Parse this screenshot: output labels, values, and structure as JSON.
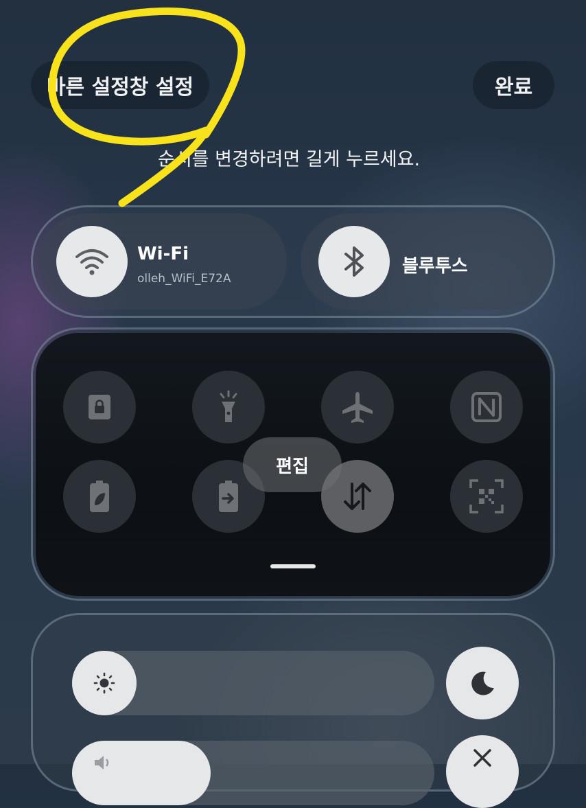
{
  "header": {
    "title": "바른 설정창 설정",
    "done_label": "완료"
  },
  "hint_text": "순서를 변경하려면 길게 누르세요.",
  "connectivity": {
    "wifi": {
      "title": "Wi-Fi",
      "network": "olleh_WiFi_E72A",
      "icon": "wifi-icon"
    },
    "bluetooth": {
      "title": "블루투스",
      "icon": "bluetooth-icon"
    }
  },
  "quick_tiles": [
    {
      "icon": "lock-icon",
      "active": false
    },
    {
      "icon": "flashlight-icon",
      "active": false
    },
    {
      "icon": "airplane-icon",
      "active": false
    },
    {
      "icon": "nfc-icon",
      "active": false
    },
    {
      "icon": "power-saving-icon",
      "active": false
    },
    {
      "icon": "battery-share-icon",
      "active": false
    },
    {
      "icon": "mobile-data-icon",
      "active": true
    },
    {
      "icon": "qr-scanner-icon",
      "active": false
    }
  ],
  "edit_label": "편집",
  "brightness": {
    "icon": "sun-icon",
    "level": 0.1
  },
  "dark_mode": {
    "icon": "moon-icon"
  },
  "volume": {
    "icon": "sound-icon",
    "level": 0.25
  },
  "mute": {
    "icon": "mute-icon"
  },
  "annotation_color": "#f7e21c",
  "colors": {
    "tile_on": "#e7e8e9",
    "panel_dark": "#0c1014"
  }
}
